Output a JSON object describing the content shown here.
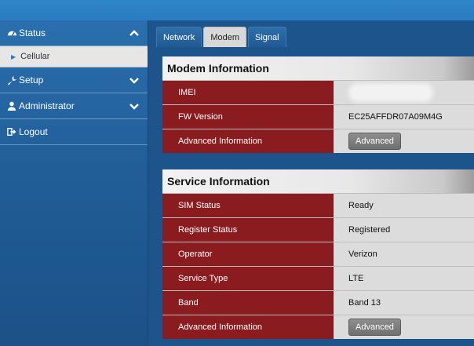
{
  "sidebar": {
    "items": [
      {
        "label": "Status",
        "icon": "dashboard-icon",
        "chevron": "up"
      },
      {
        "label": "Setup",
        "icon": "wrench-icon",
        "chevron": "down"
      },
      {
        "label": "Administrator",
        "icon": "user-icon",
        "chevron": "down"
      },
      {
        "label": "Logout",
        "icon": "logout-icon"
      }
    ],
    "subitem": {
      "label": "Cellular"
    }
  },
  "tabs": [
    {
      "label": "Network",
      "active": false
    },
    {
      "label": "Modem",
      "active": true
    },
    {
      "label": "Signal",
      "active": false
    }
  ],
  "modem_info": {
    "title": "Modem Information",
    "rows": [
      {
        "label": "IMEI",
        "value": ""
      },
      {
        "label": "FW Version",
        "value": "EC25AFFDR07A09M4G"
      },
      {
        "label": "Advanced Information",
        "button": "Advanced"
      }
    ]
  },
  "service_info": {
    "title": "Service Information",
    "rows": [
      {
        "label": "SIM Status",
        "value": "Ready"
      },
      {
        "label": "Register Status",
        "value": "Registered"
      },
      {
        "label": "Operator",
        "value": "Verizon"
      },
      {
        "label": "Service Type",
        "value": "LTE"
      },
      {
        "label": "Band",
        "value": "Band 13"
      },
      {
        "label": "Advanced Information",
        "button": "Advanced"
      }
    ]
  },
  "colors": {
    "label_bg": "#8a1c1f",
    "sidebar_bg": "#215e98",
    "accent": "#2a7bc0"
  }
}
